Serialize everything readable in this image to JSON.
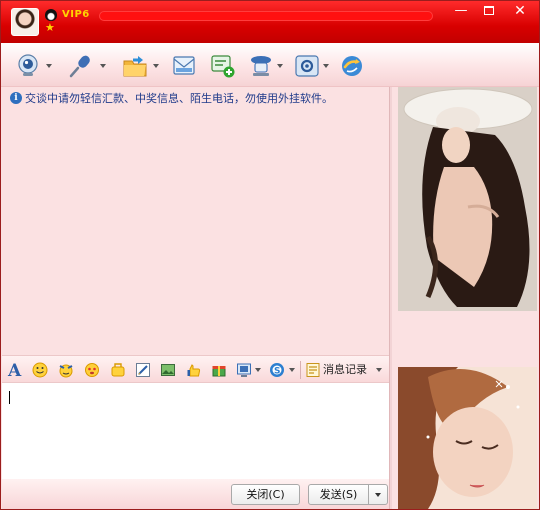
{
  "titlebar": {
    "vip_label": "VIP6",
    "minimize_glyph": "—",
    "close_glyph": "✕",
    "colors": {
      "bar": "#d80000",
      "vip": "#ffd400"
    }
  },
  "toolbar": {
    "tools": [
      {
        "name": "video",
        "icon": "webcam-icon"
      },
      {
        "name": "voice",
        "icon": "microphone-icon"
      },
      {
        "name": "file-transfer",
        "icon": "folder-icon"
      },
      {
        "name": "mail",
        "icon": "mail-icon"
      },
      {
        "name": "create-discussion",
        "icon": "add-discussion-icon"
      },
      {
        "name": "remote-assist",
        "icon": "assist-icon"
      },
      {
        "name": "apps",
        "icon": "apps-icon"
      },
      {
        "name": "share",
        "icon": "share-icon"
      }
    ]
  },
  "notice": {
    "text": "交谈中请勿轻信汇款、中奖信息、陌生电话，勿使用外挂软件。"
  },
  "format_bar": {
    "history_label": "消息记录"
  },
  "input": {
    "value": ""
  },
  "buttons": {
    "close_label": "关闭(C)",
    "send_label": "发送(S)"
  }
}
